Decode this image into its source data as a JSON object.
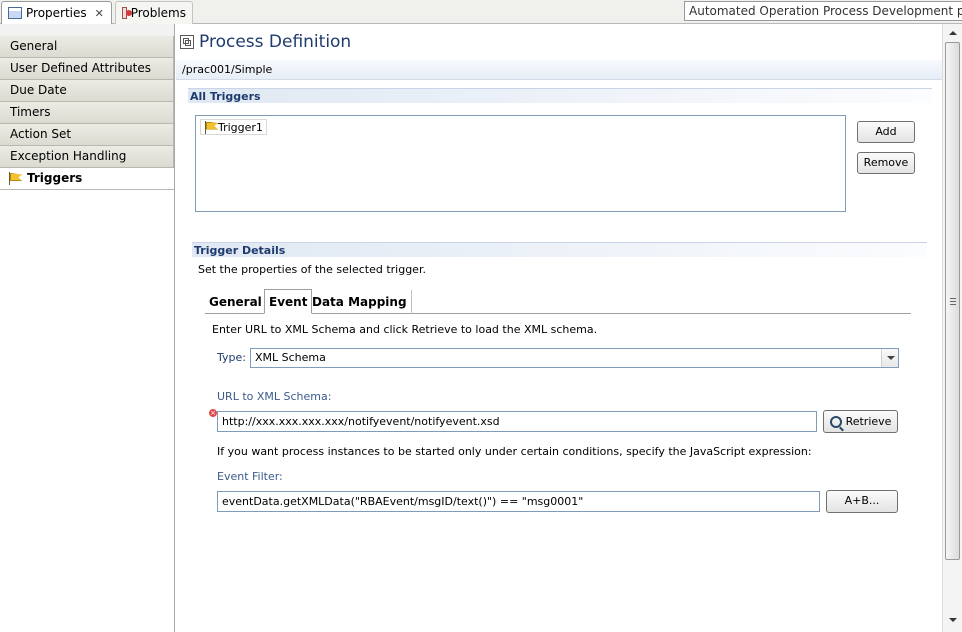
{
  "tabs": {
    "properties": "Properties",
    "properties_close": "✕",
    "problems": "Problems"
  },
  "perspective_title": "Automated Operation Process Development perspective",
  "categories": [
    {
      "label": "General"
    },
    {
      "label": "User Defined Attributes"
    },
    {
      "label": "Due Date"
    },
    {
      "label": "Timers"
    },
    {
      "label": "Action Set"
    },
    {
      "label": "Exception Handling"
    },
    {
      "label": "Triggers",
      "selected": true
    }
  ],
  "main": {
    "title": "Process Definition",
    "path": "/prac001/Simple",
    "all_triggers": {
      "header": "All Triggers",
      "items": [
        "Trigger1"
      ],
      "add_label": "Add",
      "remove_label": "Remove"
    },
    "details": {
      "header": "Trigger Details",
      "description": "Set the properties of the selected trigger.",
      "tabs": [
        "General",
        "Event",
        "Data Mapping"
      ],
      "active_tab": "Event",
      "schema_description": "Enter URL to XML Schema and click Retrieve to load the XML schema.",
      "type_label": "Type:",
      "type_value": "XML Schema",
      "url_label": "URL to XML Schema:",
      "url_value": "http://xxx.xxx.xxx.xxx/notifyevent/notifyevent.xsd",
      "retrieve_label": "Retrieve",
      "filter_description": "If you want process instances to be started only under certain conditions, specify the JavaScript expression:",
      "filter_label": "Event Filter:",
      "filter_value": "eventData.getXMLData(\"RBAEvent/msgID/text()\")  == \"msg0001\"",
      "ab_label": "A+B..."
    }
  }
}
